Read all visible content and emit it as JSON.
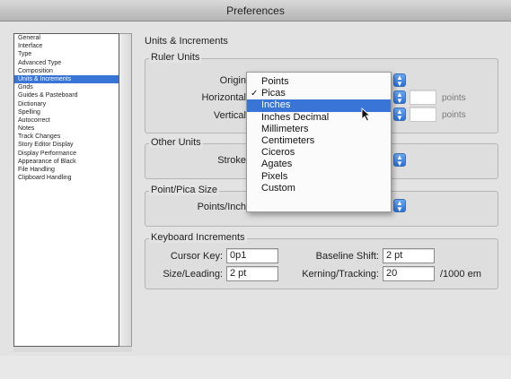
{
  "window": {
    "title": "Preferences"
  },
  "sidebar": {
    "items": [
      {
        "label": "General",
        "selected": false
      },
      {
        "label": "Interface",
        "selected": false
      },
      {
        "label": "Type",
        "selected": false
      },
      {
        "label": "Advanced Type",
        "selected": false
      },
      {
        "label": "Composition",
        "selected": false
      },
      {
        "label": "Units & Increments",
        "selected": true
      },
      {
        "label": "Grids",
        "selected": false
      },
      {
        "label": "Guides & Pasteboard",
        "selected": false
      },
      {
        "label": "Dictionary",
        "selected": false
      },
      {
        "label": "Spelling",
        "selected": false
      },
      {
        "label": "Autocorrect",
        "selected": false
      },
      {
        "label": "Notes",
        "selected": false
      },
      {
        "label": "Track Changes",
        "selected": false
      },
      {
        "label": "Story Editor Display",
        "selected": false
      },
      {
        "label": "Display Performance",
        "selected": false
      },
      {
        "label": "Appearance of Black",
        "selected": false
      },
      {
        "label": "File Handling",
        "selected": false
      },
      {
        "label": "Clipboard Handling",
        "selected": false
      }
    ]
  },
  "main": {
    "title": "Units & Increments",
    "ruler_units": {
      "group_label": "Ruler Units",
      "origin_label": "Origin",
      "horizontal_label": "Horizontal",
      "vertical_label": "Vertical",
      "horizontal_suffix": "points",
      "vertical_suffix": "points"
    },
    "other_units": {
      "group_label": "Other Units",
      "stroke_label": "Stroke"
    },
    "point_pica": {
      "group_label": "Point/Pica Size",
      "points_inch_label": "Points/Inch"
    },
    "keyboard_increments": {
      "group_label": "Keyboard Increments",
      "cursor_key_label": "Cursor Key:",
      "cursor_key_value": "0p1",
      "size_leading_label": "Size/Leading:",
      "size_leading_value": "2 pt",
      "baseline_shift_label": "Baseline Shift:",
      "baseline_shift_value": "2 pt",
      "kerning_label": "Kerning/Tracking:",
      "kerning_value": "20",
      "kerning_suffix": "/1000 em"
    }
  },
  "dropdown": {
    "check_glyph": "✓",
    "items": [
      {
        "label": "Points",
        "checked": false,
        "highlighted": false
      },
      {
        "label": "Picas",
        "checked": true,
        "highlighted": false
      },
      {
        "label": "Inches",
        "checked": false,
        "highlighted": true
      },
      {
        "label": "Inches Decimal",
        "checked": false,
        "highlighted": false
      },
      {
        "label": "Millimeters",
        "checked": false,
        "highlighted": false
      },
      {
        "label": "Centimeters",
        "checked": false,
        "highlighted": false
      },
      {
        "label": "Ciceros",
        "checked": false,
        "highlighted": false
      },
      {
        "label": "Agates",
        "checked": false,
        "highlighted": false
      },
      {
        "label": "Pixels",
        "checked": false,
        "highlighted": false
      },
      {
        "label": "Custom",
        "checked": false,
        "highlighted": false
      }
    ]
  },
  "colors": {
    "accent": "#3875d7",
    "popup_arrow": "#2b6fd6"
  },
  "icons": {
    "select_arrows": "up-down-arrows-icon",
    "pointer": "mouse-pointer-icon"
  }
}
